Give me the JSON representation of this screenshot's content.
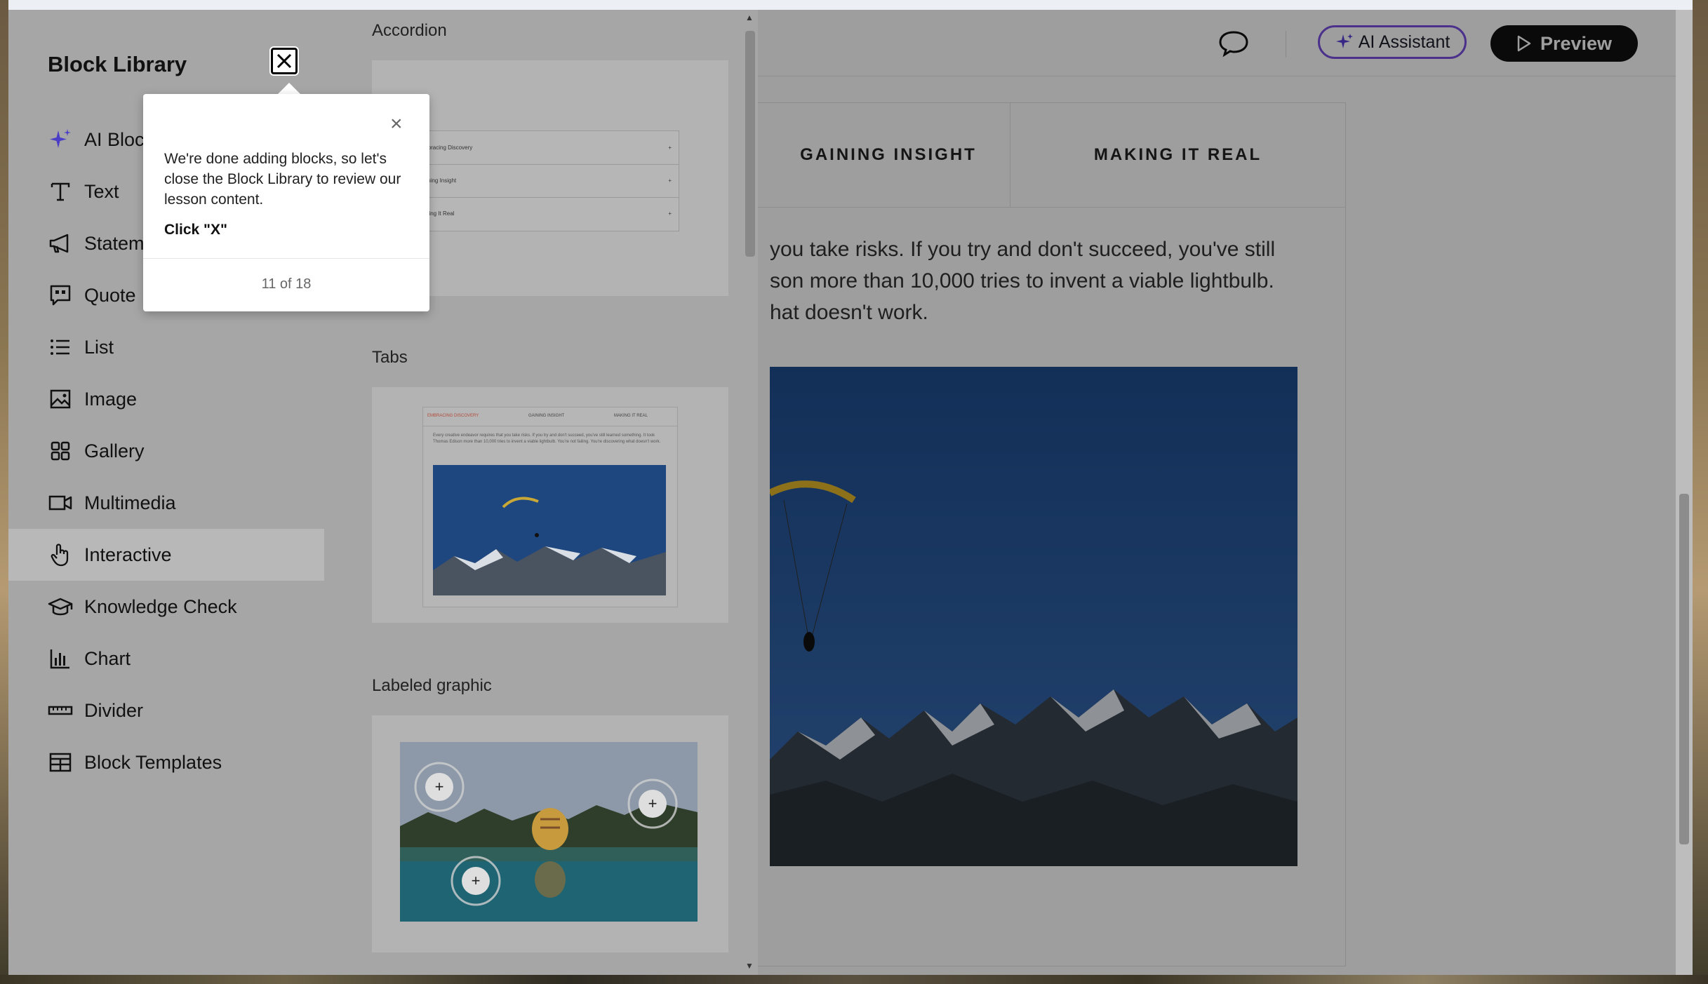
{
  "header": {
    "ai_assistant_label": "AI Assistant",
    "preview_label": "Preview"
  },
  "lesson": {
    "tabs": [
      "GAINING INSIGHT",
      "MAKING IT REAL"
    ],
    "text_lines": [
      "you take risks. If you try and don't succeed, you've still",
      "son more than 10,000 tries to invent a viable lightbulb.",
      "hat doesn't work."
    ]
  },
  "library": {
    "title": "Block Library",
    "items": [
      {
        "label": "AI Block",
        "icon": "sparkle-icon"
      },
      {
        "label": "Text",
        "icon": "text-icon"
      },
      {
        "label": "Statement",
        "icon": "megaphone-icon"
      },
      {
        "label": "Quote",
        "icon": "quote-icon"
      },
      {
        "label": "List",
        "icon": "list-icon"
      },
      {
        "label": "Image",
        "icon": "image-icon"
      },
      {
        "label": "Gallery",
        "icon": "gallery-icon"
      },
      {
        "label": "Multimedia",
        "icon": "video-icon"
      },
      {
        "label": "Interactive",
        "icon": "pointer-hand-icon",
        "active": true
      },
      {
        "label": "Knowledge Check",
        "icon": "graduation-cap-icon"
      },
      {
        "label": "Chart",
        "icon": "bar-chart-icon"
      },
      {
        "label": "Divider",
        "icon": "divider-icon"
      },
      {
        "label": "Block Templates",
        "icon": "template-icon"
      }
    ],
    "sections": [
      {
        "label": "Accordion",
        "rows": [
          "mbracing Discovery",
          "aining Insight",
          "aking It Real"
        ]
      },
      {
        "label": "Tabs",
        "tabs": [
          "EMBRACING DISCOVERY",
          "GAINING INSIGHT",
          "MAKING IT REAL"
        ],
        "body": "Every creative endeavor requires that you take risks. If you try and don't succeed, you've still learned something. It took Thomas Edison more than 10,000 tries to invent a viable lightbulb. You're not failing. You're discovering what doesn't work."
      },
      {
        "label": "Labeled graphic",
        "markers": [
          "+",
          "+",
          "+"
        ]
      }
    ]
  },
  "tooltip": {
    "body": "We're done adding blocks, so let's close the Block Library to review our lesson content.",
    "action": "Click \"X\"",
    "step": "11 of 18"
  },
  "colors": {
    "accent": "#7a4fe0",
    "preview_bg": "#111111",
    "overlay": "#a6a6a6"
  }
}
